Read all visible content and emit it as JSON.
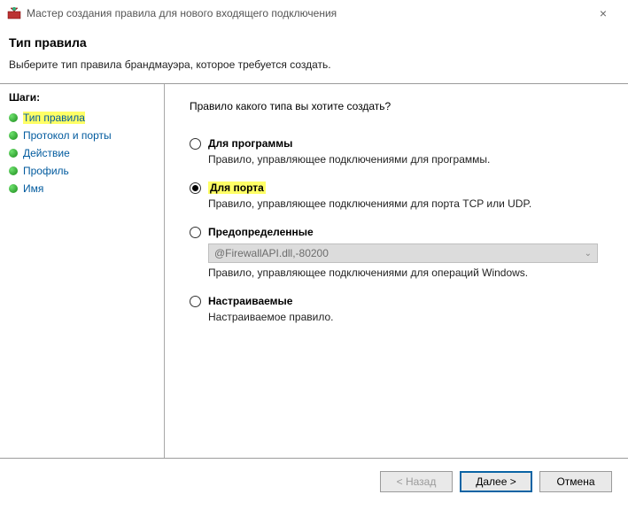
{
  "window": {
    "title": "Мастер создания правила для нового входящего подключения"
  },
  "header": {
    "title": "Тип правила",
    "subtitle": "Выберите тип правила брандмауэра, которое требуется создать."
  },
  "sidebar": {
    "title": "Шаги:",
    "items": [
      {
        "label": "Тип правила",
        "current": true
      },
      {
        "label": "Протокол и порты",
        "current": false
      },
      {
        "label": "Действие",
        "current": false
      },
      {
        "label": "Профиль",
        "current": false
      },
      {
        "label": "Имя",
        "current": false
      }
    ]
  },
  "main": {
    "question": "Правило какого типа вы хотите создать?",
    "options": [
      {
        "id": "program",
        "label": "Для программы",
        "desc": "Правило, управляющее подключениями для программы.",
        "checked": false
      },
      {
        "id": "port",
        "label": "Для порта",
        "desc": "Правило, управляющее подключениями для порта TCP или UDP.",
        "checked": true,
        "highlight": true
      },
      {
        "id": "predefined",
        "label": "Предопределенные",
        "desc": "Правило, управляющее подключениями для операций Windows.",
        "checked": false,
        "combo": "@FirewallAPI.dll,-80200"
      },
      {
        "id": "custom",
        "label": "Настраиваемые",
        "desc": "Настраиваемое правило.",
        "checked": false
      }
    ]
  },
  "footer": {
    "back": "< Назад",
    "next": "Далее >",
    "cancel": "Отмена"
  }
}
